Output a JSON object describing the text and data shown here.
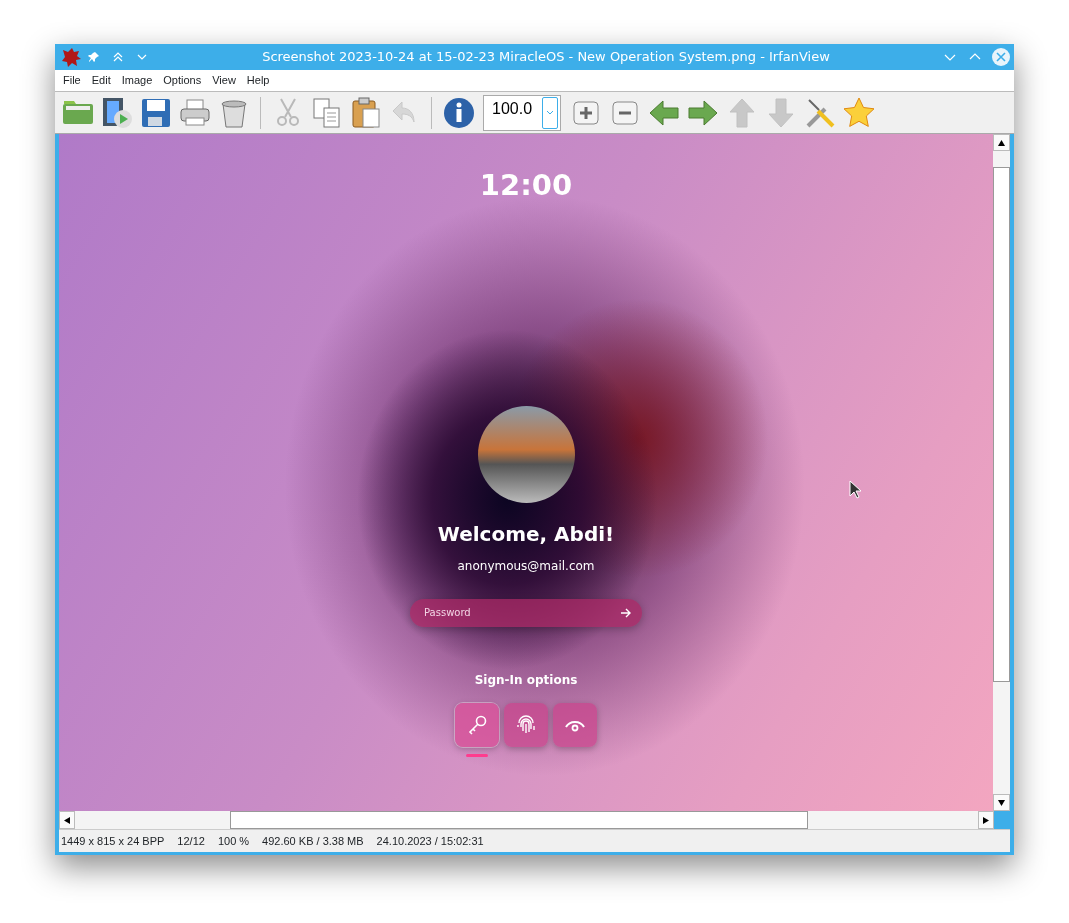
{
  "window": {
    "title": "Screenshot 2023-10-24 at 15-02-23 MiracleOS - New Operation System.png - IrfanView"
  },
  "menu": [
    "File",
    "Edit",
    "Image",
    "Options",
    "View",
    "Help"
  ],
  "toolbar": [
    {
      "kind": "open",
      "disabled": false
    },
    {
      "kind": "slideshow",
      "disabled": false
    },
    {
      "kind": "save",
      "disabled": false
    },
    {
      "kind": "print",
      "disabled": false
    },
    {
      "kind": "delete",
      "disabled": false
    },
    {
      "kind": "separator"
    },
    {
      "kind": "cut",
      "disabled": true
    },
    {
      "kind": "copy",
      "disabled": false
    },
    {
      "kind": "paste",
      "disabled": false
    },
    {
      "kind": "undo",
      "disabled": true
    },
    {
      "kind": "separator"
    },
    {
      "kind": "info",
      "disabled": false
    },
    {
      "kind": "zoom",
      "value": "100.0"
    },
    {
      "kind": "zoom-in",
      "disabled": false
    },
    {
      "kind": "zoom-out",
      "disabled": false
    },
    {
      "kind": "previous",
      "disabled": false
    },
    {
      "kind": "next",
      "disabled": false
    },
    {
      "kind": "up",
      "disabled": true
    },
    {
      "kind": "down",
      "disabled": true
    },
    {
      "kind": "tools",
      "disabled": false
    },
    {
      "kind": "favorite",
      "disabled": false
    }
  ],
  "login": {
    "clock": "12:00",
    "welcome": "Welcome, Abdi!",
    "email": "anonymous@mail.com",
    "password": {
      "placeholder": "Password"
    },
    "signin_label": "Sign-In options",
    "options": [
      {
        "kind": "key",
        "selected": true
      },
      {
        "kind": "fingerprint",
        "selected": false
      },
      {
        "kind": "eye",
        "selected": false
      }
    ]
  },
  "status_bar": [
    "1449 x 815 x 24 BPP",
    "12/12",
    "100 %",
    "492.60 KB / 3.38 MB",
    "24.10.2023 / 15:02:31"
  ]
}
